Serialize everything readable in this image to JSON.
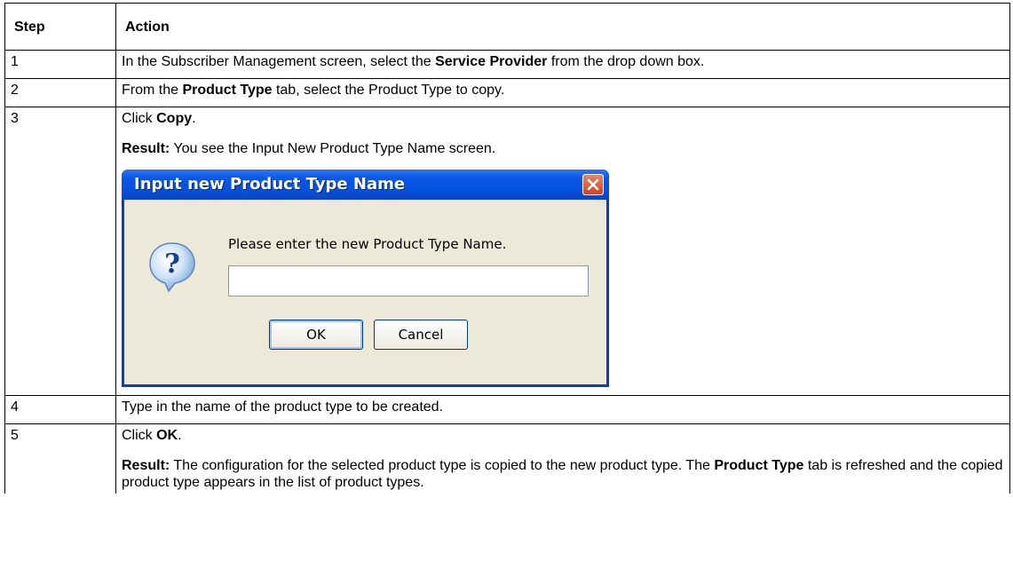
{
  "table": {
    "headers": {
      "step": "Step",
      "action": "Action"
    },
    "rows": [
      {
        "step": "1",
        "pre": "In the Subscriber Management screen, select the ",
        "bold": "Service Provider",
        "post": " from the drop down box."
      },
      {
        "step": "2",
        "pre": "From the ",
        "bold": "Product Type",
        "post": " tab, select the Product Type to copy."
      },
      {
        "step": "3",
        "pre": "Click ",
        "bold": "Copy",
        "post": ".",
        "result_label": "Result:",
        "result_text": " You see the Input New Product Type Name screen."
      },
      {
        "step": "4",
        "text": "Type in the name of the product type to be created."
      },
      {
        "step": "5",
        "pre": "Click ",
        "bold": "OK",
        "post": ".",
        "result_label": "Result:",
        "result_text": " The configuration for the selected product type is copied to the new product type. The ",
        "result_bold": "Product Type",
        "result_text2": " tab is refreshed and the copied product type appears in the list of product types."
      }
    ]
  },
  "dialog": {
    "title": "Input new Product Type Name",
    "prompt": "Please enter the new Product Type Name.",
    "input_value": "",
    "ok_label": "OK",
    "cancel_label": "Cancel",
    "icon": "question-icon",
    "close_icon": "close-icon"
  }
}
